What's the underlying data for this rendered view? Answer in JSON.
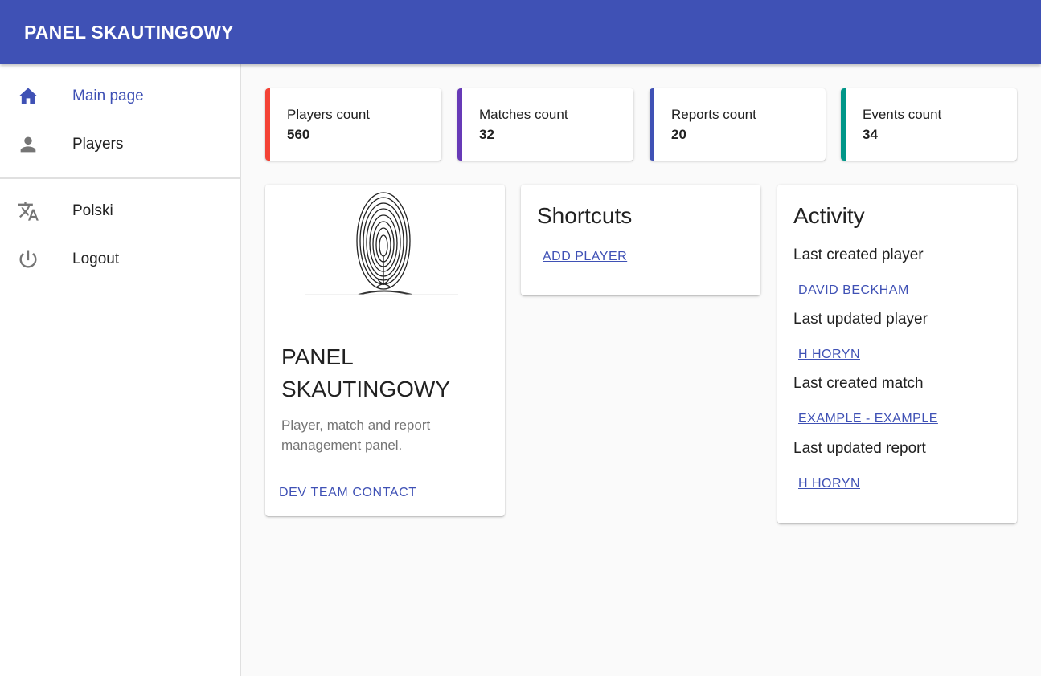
{
  "app": {
    "title": "PANEL SKAUTINGOWY"
  },
  "sidebar": {
    "items": [
      {
        "label": "Main page",
        "icon": "home-icon",
        "active": true
      },
      {
        "label": "Players",
        "icon": "person-icon",
        "active": false
      },
      {
        "label": "Polski",
        "icon": "translate-icon",
        "active": false
      },
      {
        "label": "Logout",
        "icon": "power-icon",
        "active": false
      }
    ]
  },
  "stats": [
    {
      "label": "Players count",
      "value": "560",
      "color": "#f44336"
    },
    {
      "label": "Matches count",
      "value": "32",
      "color": "#673ab7"
    },
    {
      "label": "Reports count",
      "value": "20",
      "color": "#3f51b5"
    },
    {
      "label": "Events count",
      "value": "34",
      "color": "#009688"
    }
  ],
  "info_card": {
    "title": "PANEL SKAUTINGOWY",
    "description": "Player, match and report management panel.",
    "contact_label": "DEV TEAM CONTACT",
    "image_icon": "fingerprint-icon"
  },
  "shortcuts": {
    "title": "Shortcuts",
    "add_player_label": "ADD PLAYER"
  },
  "activity": {
    "title": "Activity",
    "items": [
      {
        "label": "Last created player",
        "link": "DAVID BECKHAM"
      },
      {
        "label": "Last updated player",
        "link": "H HORYN"
      },
      {
        "label": "Last created match",
        "link": "EXAMPLE - EXAMPLE"
      },
      {
        "label": "Last updated report",
        "link": "H HORYN"
      }
    ]
  },
  "colors": {
    "primary": "#3f51b5",
    "icon": "#757575"
  }
}
